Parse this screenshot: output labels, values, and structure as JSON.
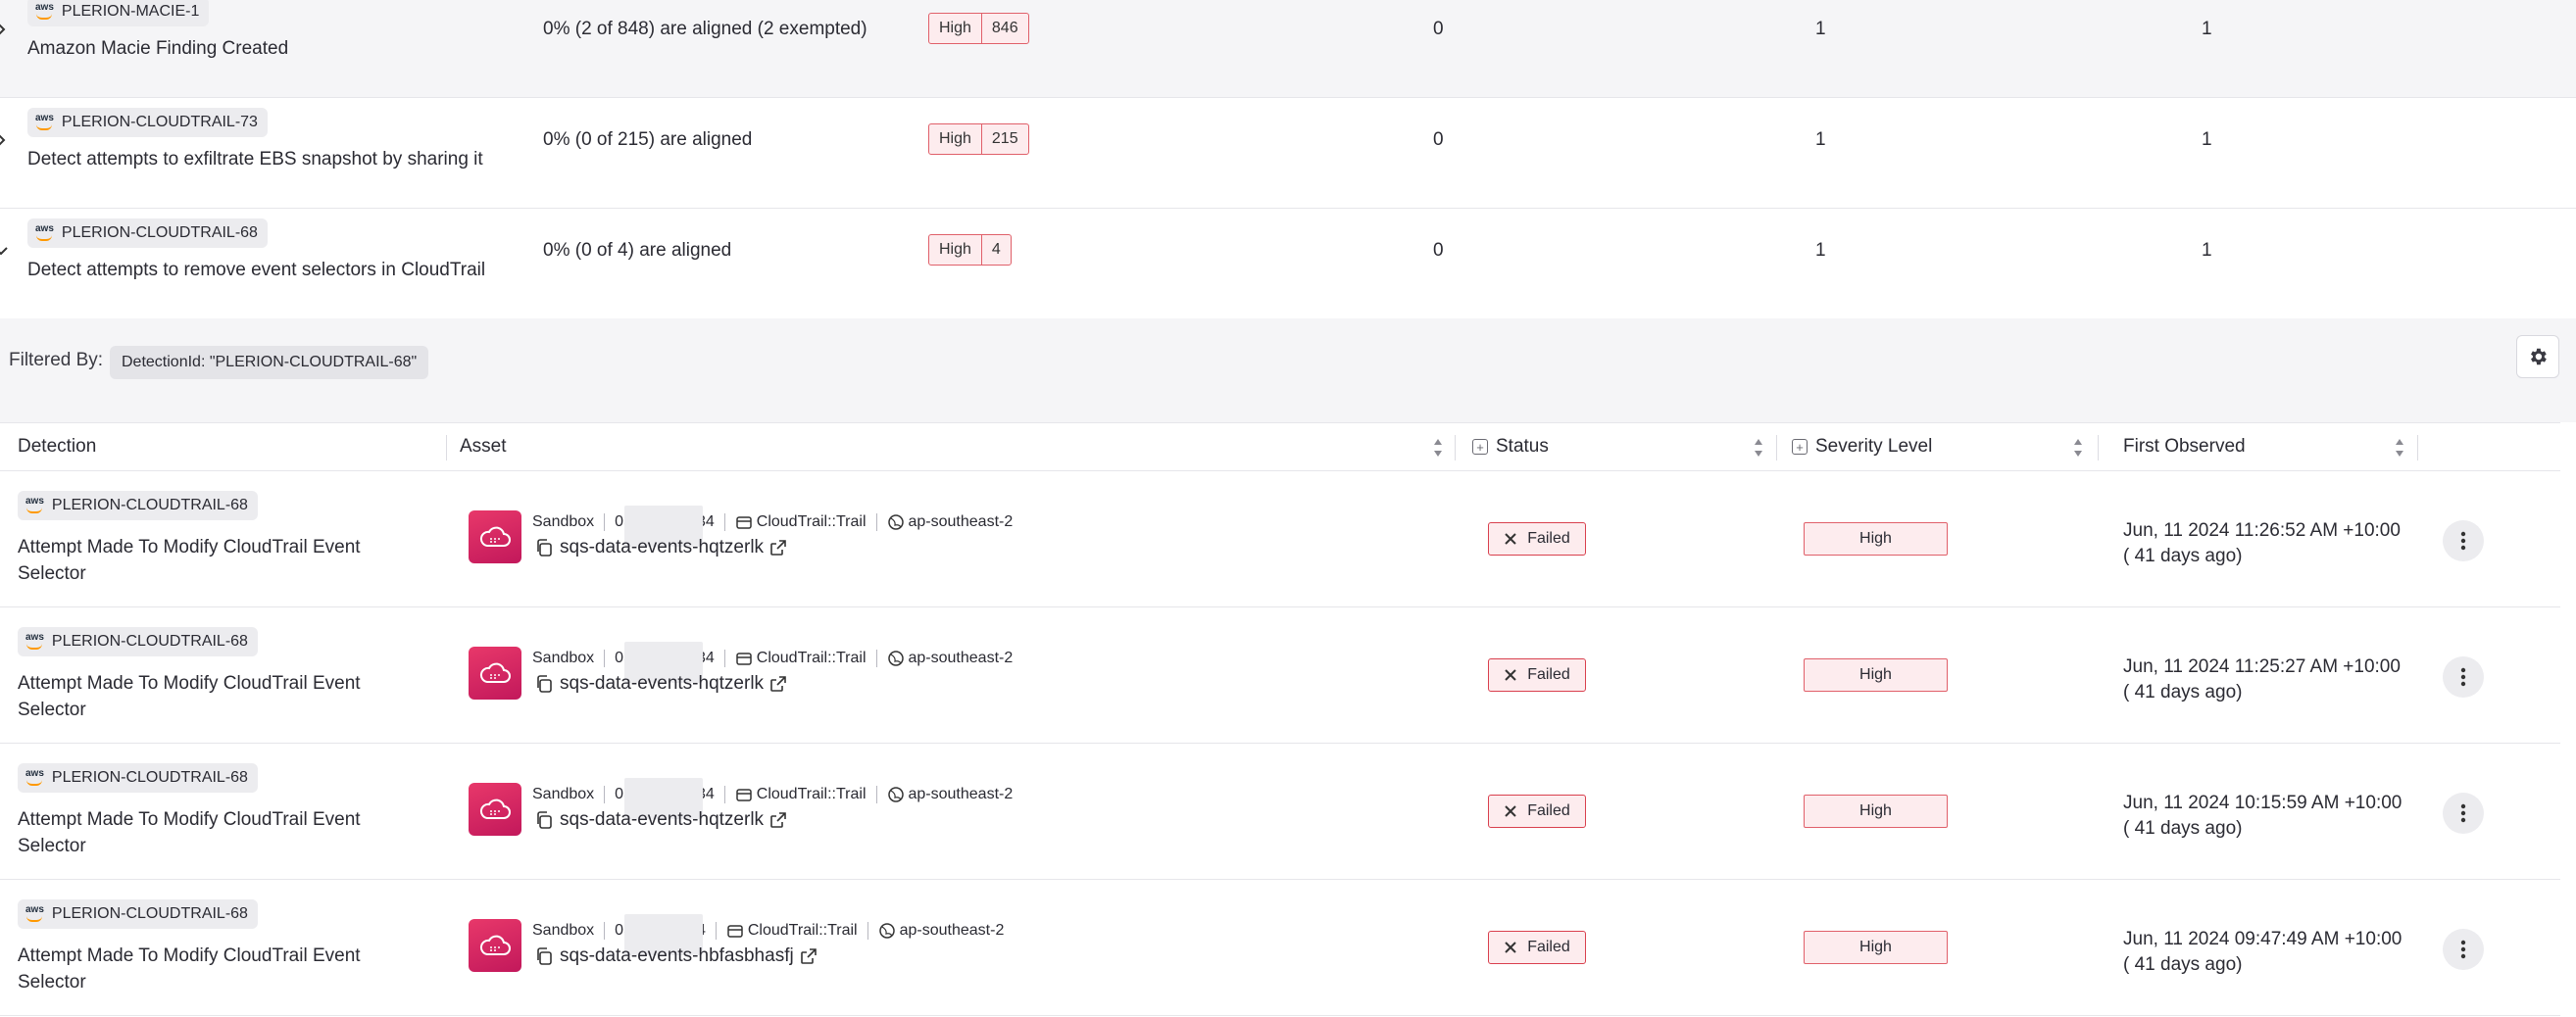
{
  "top_rows": [
    {
      "detection_id": "PLERION-MACIE-1",
      "title": "Amazon Macie Finding Created",
      "aligned": "0% (2 of 848) are aligned (2 exempted)",
      "severity": "High",
      "severity_count": "846",
      "col_a": "0",
      "col_b": "1",
      "col_c": "1",
      "expander": "chevron-right"
    },
    {
      "detection_id": "PLERION-CLOUDTRAIL-73",
      "title": "Detect attempts to exfiltrate EBS snapshot by sharing it",
      "aligned": "0% (0 of 215) are aligned",
      "severity": "High",
      "severity_count": "215",
      "col_a": "0",
      "col_b": "1",
      "col_c": "1",
      "expander": "chevron-right"
    },
    {
      "detection_id": "PLERION-CLOUDTRAIL-68",
      "title": "Detect attempts to remove event selectors in CloudTrail",
      "aligned": "0% (0 of 4) are aligned",
      "severity": "High",
      "severity_count": "4",
      "col_a": "0",
      "col_b": "1",
      "col_c": "1",
      "expander": "chevron-down"
    }
  ],
  "filter": {
    "label": "Filtered By:",
    "chip": "DetectionId:  \"PLERION-CLOUDTRAIL-68\""
  },
  "grid": {
    "headers": {
      "detection": "Detection",
      "asset": "Asset",
      "status": "Status",
      "severity": "Severity Level",
      "first_observed": "First Observed"
    },
    "rows": [
      {
        "detection_id": "PLERION-CLOUDTRAIL-68",
        "title": "Attempt Made To Modify CloudTrail Event Selector",
        "account_name": "Sandbox",
        "account_prefix": "05",
        "account_suffix": "34",
        "resource_type": "CloudTrail::Trail",
        "region": "ap-southeast-2",
        "asset_name": "sqs-data-events-hqtzerlk",
        "status": "Failed",
        "severity": "High",
        "first_observed": "Jun, 11 2024 11:26:52 AM +10:00",
        "relative": "( 41 days ago)"
      },
      {
        "detection_id": "PLERION-CLOUDTRAIL-68",
        "title": "Attempt Made To Modify CloudTrail Event Selector",
        "account_name": "Sandbox",
        "account_prefix": "05",
        "account_suffix": "34",
        "resource_type": "CloudTrail::Trail",
        "region": "ap-southeast-2",
        "asset_name": "sqs-data-events-hqtzerlk",
        "status": "Failed",
        "severity": "High",
        "first_observed": "Jun, 11 2024 11:25:27 AM +10:00",
        "relative": "( 41 days ago)"
      },
      {
        "detection_id": "PLERION-CLOUDTRAIL-68",
        "title": "Attempt Made To Modify CloudTrail Event Selector",
        "account_name": "Sandbox",
        "account_prefix": "05",
        "account_suffix": "34",
        "resource_type": "CloudTrail::Trail",
        "region": "ap-southeast-2",
        "asset_name": "sqs-data-events-hqtzerlk",
        "status": "Failed",
        "severity": "High",
        "first_observed": "Jun, 11 2024 10:15:59 AM +10:00",
        "relative": "( 41 days ago)"
      },
      {
        "detection_id": "PLERION-CLOUDTRAIL-68",
        "title": "Attempt Made To Modify CloudTrail Event Selector",
        "account_name": "Sandbox",
        "account_prefix": "05",
        "account_suffix": "4",
        "resource_type": "CloudTrail::Trail",
        "region": "ap-southeast-2",
        "asset_name": "sqs-data-events-hbfasbhasfj",
        "status": "Failed",
        "severity": "High",
        "first_observed": "Jun, 11 2024 09:47:49 AM +10:00",
        "relative": "( 41 days ago)"
      }
    ]
  },
  "icons": {
    "aws_logo": "aws",
    "asset": "cloud-trail-icon",
    "copy": "copy-icon",
    "external_link": "external-link-icon",
    "account": "account-icon",
    "region": "globe-icon",
    "status_failed": "close-icon",
    "more": "more-vertical-icon",
    "settings": "gear-icon"
  },
  "colors": {
    "failed_border": "#d9404e",
    "badge_fill": "#fdecee",
    "asset_tile": "#d81b60",
    "aws_orange": "#ff9900"
  }
}
